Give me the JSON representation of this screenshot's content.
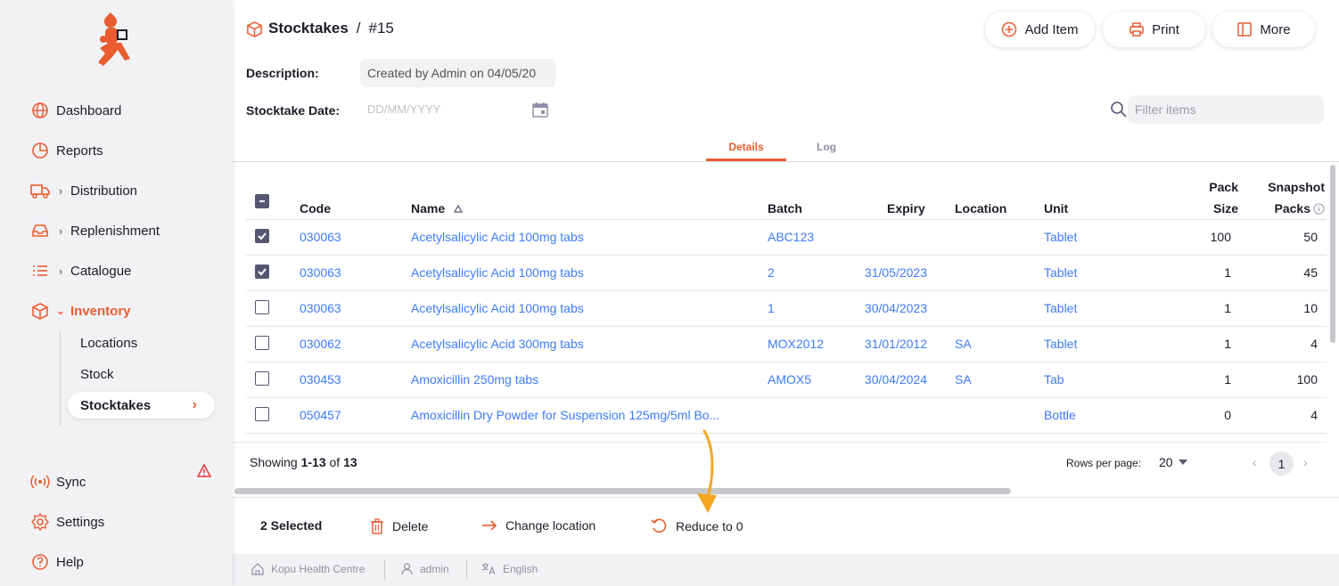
{
  "sidebar": {
    "nav": [
      {
        "label": "Dashboard",
        "icon": "globe-icon"
      },
      {
        "label": "Reports",
        "icon": "pie-chart-icon"
      },
      {
        "label": "Distribution",
        "icon": "truck-icon"
      },
      {
        "label": "Replenishment",
        "icon": "inbox-icon"
      },
      {
        "label": "Catalogue",
        "icon": "list-icon"
      },
      {
        "label": "Inventory",
        "icon": "box-icon"
      }
    ],
    "sub": [
      "Locations",
      "Stock",
      "Stocktakes"
    ],
    "bottom": [
      {
        "label": "Sync",
        "icon": "sync-icon"
      },
      {
        "label": "Settings",
        "icon": "gear-icon"
      },
      {
        "label": "Help",
        "icon": "help-icon"
      }
    ]
  },
  "header": {
    "crumb_root": "Stocktakes",
    "crumb_sep": "/",
    "crumb_current": "#15",
    "buttons": {
      "add_item": "Add Item",
      "print": "Print",
      "more": "More"
    }
  },
  "form": {
    "description_label": "Description:",
    "description_value": "Created by Admin on 04/05/20",
    "date_label": "Stocktake Date:",
    "date_placeholder": "DD/MM/YYYY",
    "filter_placeholder": "Filter items"
  },
  "tabs": {
    "details": "Details",
    "log": "Log"
  },
  "table": {
    "headers": {
      "code": "Code",
      "name": "Name",
      "batch": "Batch",
      "expiry": "Expiry",
      "location": "Location",
      "unit": "Unit",
      "pack_size_1": "Pack",
      "pack_size_2": "Size",
      "snapshot_1": "Snapshot",
      "snapshot_2": "Packs"
    },
    "rows": [
      {
        "checked": true,
        "code": "030063",
        "name": "Acetylsalicylic Acid 100mg tabs",
        "batch": "ABC123",
        "expiry": "",
        "location": "",
        "unit": "Tablet",
        "pack_size": "100",
        "snapshot": "50"
      },
      {
        "checked": true,
        "code": "030063",
        "name": "Acetylsalicylic Acid 100mg tabs",
        "batch": "2",
        "expiry": "31/05/2023",
        "location": "",
        "unit": "Tablet",
        "pack_size": "1",
        "snapshot": "45"
      },
      {
        "checked": false,
        "code": "030063",
        "name": "Acetylsalicylic Acid 100mg tabs",
        "batch": "1",
        "expiry": "30/04/2023",
        "location": "",
        "unit": "Tablet",
        "pack_size": "1",
        "snapshot": "10"
      },
      {
        "checked": false,
        "code": "030062",
        "name": "Acetylsalicylic Acid 300mg tabs",
        "batch": "MOX2012",
        "expiry": "31/01/2012",
        "location": "SA",
        "unit": "Tablet",
        "pack_size": "1",
        "snapshot": "4"
      },
      {
        "checked": false,
        "code": "030453",
        "name": "Amoxicillin 250mg tabs",
        "batch": "AMOX5",
        "expiry": "30/04/2024",
        "location": "SA",
        "unit": "Tab",
        "pack_size": "1",
        "snapshot": "100"
      },
      {
        "checked": false,
        "code": "050457",
        "name": "Amoxicillin Dry Powder for Suspension 125mg/5ml Bo...",
        "batch": "",
        "expiry": "",
        "location": "",
        "unit": "Bottle",
        "pack_size": "0",
        "snapshot": "4"
      }
    ]
  },
  "pagination": {
    "showing_prefix": "Showing ",
    "range": "1-13",
    "of": " of ",
    "total": "13",
    "rows_per_page_label": "Rows per page:",
    "rows_per_page": "20",
    "page": "1"
  },
  "actions": {
    "selected": "2 Selected",
    "delete": "Delete",
    "change_location": "Change location",
    "reduce": "Reduce to 0"
  },
  "footer": {
    "store": "Kopu Health Centre",
    "user": "admin",
    "language": "English"
  },
  "colors": {
    "accent": "#e95c30",
    "link": "#3e7bfa",
    "annotation": "#f5a623"
  }
}
